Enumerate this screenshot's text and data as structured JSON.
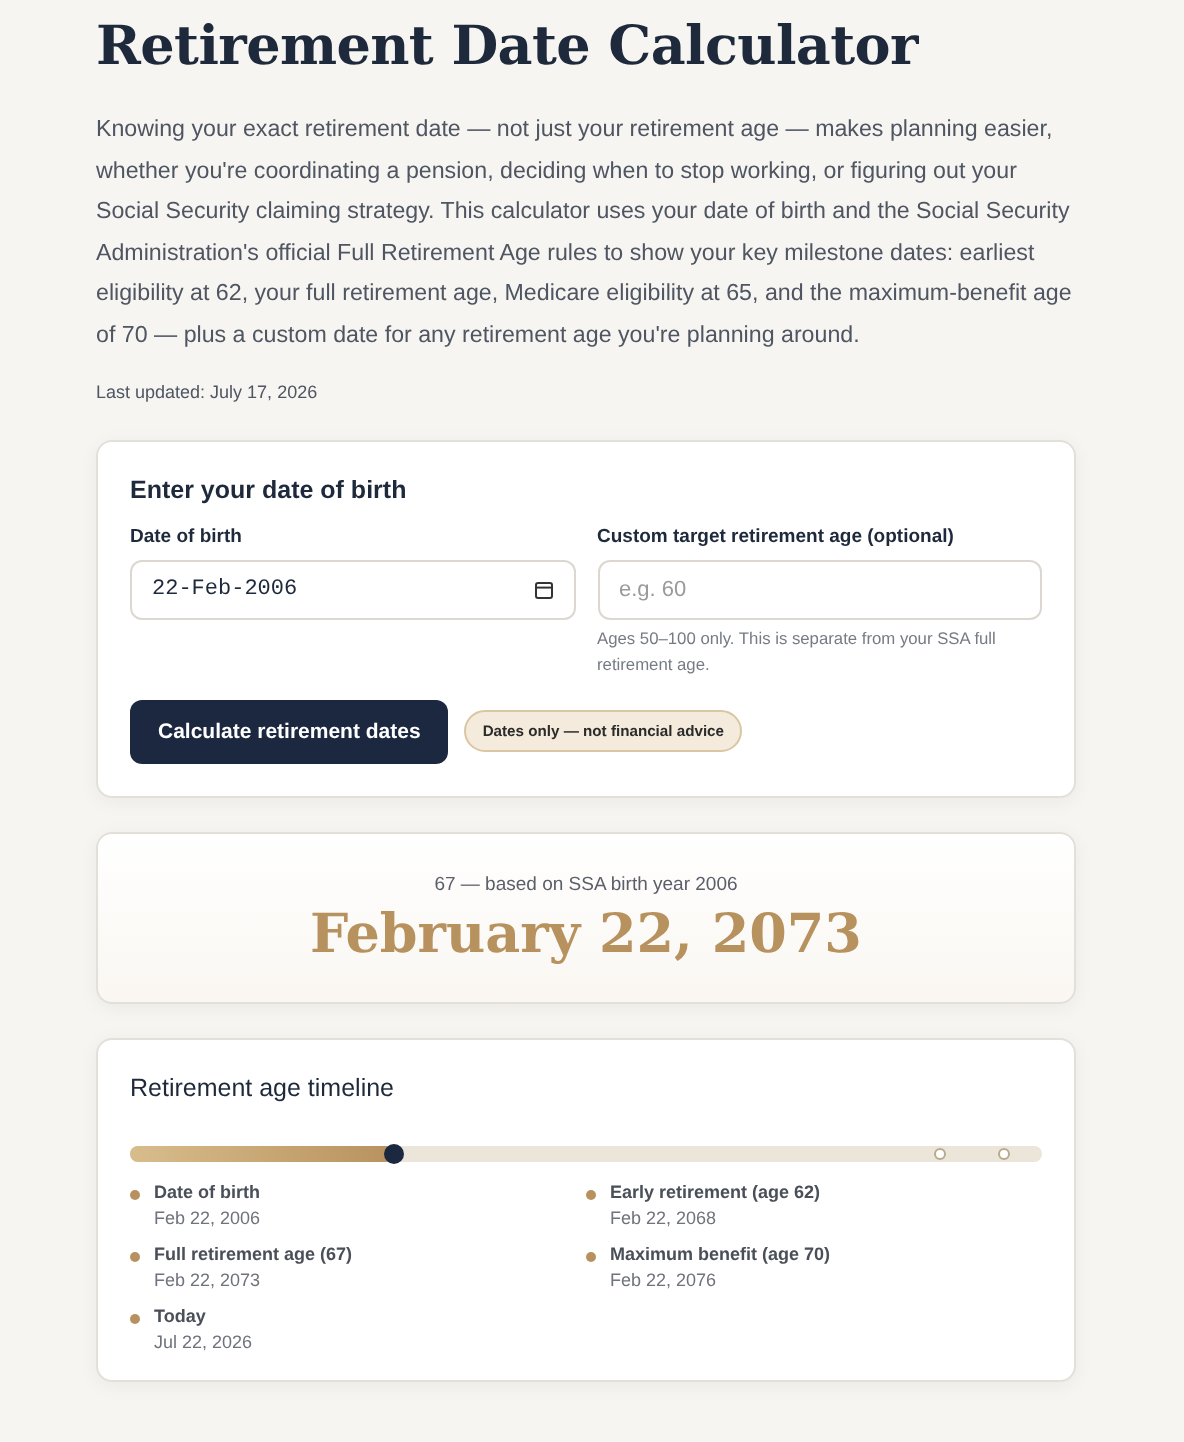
{
  "title": "Retirement Date Calculator",
  "intro": "Knowing your exact retirement date — not just your retirement age — makes planning easier, whether you're coordinating a pension, deciding when to stop working, or figuring out your Social Security claiming strategy. This calculator uses your date of birth and the Social Security Administration's official Full Retirement Age rules to show your key milestone dates: earliest eligibility at 62, your full retirement age, Medicare eligibility at 65, and the maximum-benefit age of 70 — plus a custom date for any retirement age you're planning around.",
  "updated": "Last updated: July 17, 2026",
  "form": {
    "heading": "Enter your date of birth",
    "dob_label": "Date of birth",
    "dob_value": "22-Feb-2006",
    "custom_label": "Custom target retirement age (optional)",
    "custom_placeholder": "e.g. 60",
    "custom_hint": "Ages 50–100 only. This is separate from your SSA full retirement age.",
    "button": "Calculate retirement dates",
    "badge": "Dates only — not financial advice"
  },
  "result": {
    "subtitle": "67 — based on SSA birth year 2006",
    "date": "February 22, 2073"
  },
  "timeline": {
    "heading": "Retirement age timeline",
    "level": 0.29,
    "items": [
      {
        "label": "Date of birth",
        "date": "Feb 22, 2006"
      },
      {
        "label": "Early retirement (age 62)",
        "date": "Feb 22, 2068"
      },
      {
        "label": "Full retirement age (67)",
        "date": "Feb 22, 2073"
      },
      {
        "label": "Maximum benefit (age 70)",
        "date": "Feb 22, 2076"
      },
      {
        "label": "Today",
        "date": "Jul 22, 2026"
      }
    ]
  }
}
